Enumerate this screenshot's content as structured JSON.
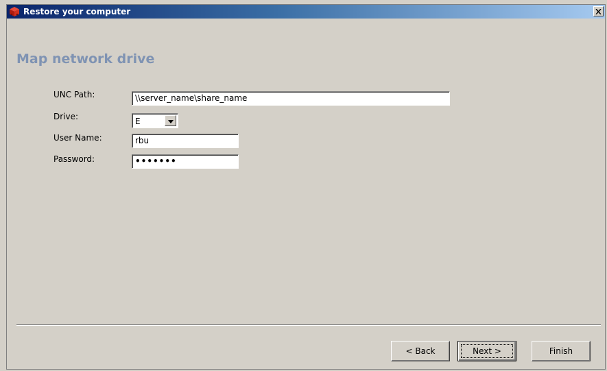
{
  "window": {
    "title": "Restore your computer",
    "icon": "app-cube-icon",
    "close_icon": "close-icon"
  },
  "page": {
    "heading": "Map network drive"
  },
  "form": {
    "unc_path": {
      "label": "UNC Path:",
      "value": "\\\\server_name\\share_name"
    },
    "drive": {
      "label": "Drive:",
      "value": "E"
    },
    "user_name": {
      "label": "User Name:",
      "value": "rbu"
    },
    "password": {
      "label": "Password:",
      "value": "•••••••"
    }
  },
  "buttons": {
    "back": "< Back",
    "next": "Next >",
    "finish": "Finish"
  },
  "colors": {
    "heading": "#7f93b3",
    "titlebar_start": "#0a246a",
    "titlebar_end": "#a6caf0",
    "face": "#d4d0c8"
  }
}
